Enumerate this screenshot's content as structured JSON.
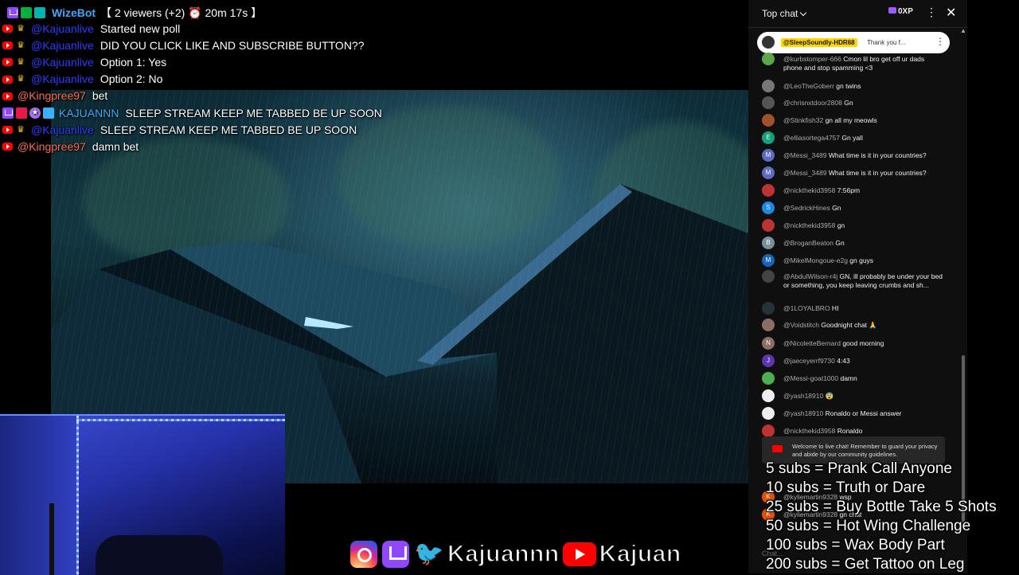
{
  "colors": {
    "wizebot": "#3ea6ff",
    "mod_blue": "#2a3cff",
    "kingpree": "#ff6a4d",
    "kajuannn": "#3ab0ff",
    "yt_bg": "#0f0f0f",
    "pinned_highlight": "#ffd600"
  },
  "viewer_bar": {
    "bot_name": "WizeBot",
    "viewers": "【 2 viewers (+2) ⏰ 20m 17s 】"
  },
  "stream_chat": [
    {
      "badges": [
        "yt",
        "crown"
      ],
      "user": "@Kajuanlive",
      "user_color": "#2a3cff",
      "msg": "Started new poll"
    },
    {
      "badges": [
        "yt",
        "crown"
      ],
      "user": "@Kajuanlive",
      "user_color": "#2a3cff",
      "msg": "DID YOU CLICK LIKE AND SUBSCRIBE BUTTON??"
    },
    {
      "badges": [
        "yt",
        "crown"
      ],
      "user": "@Kajuanlive",
      "user_color": "#2a3cff",
      "msg": "Option 1: Yes"
    },
    {
      "badges": [
        "yt",
        "crown"
      ],
      "user": "@Kajuanlive",
      "user_color": "#2a3cff",
      "msg": "Option 2: No"
    },
    {
      "badges": [
        "yt"
      ],
      "user": "@Kingpree97",
      "user_color": "#ff6a4d",
      "msg": "bet"
    },
    {
      "badges": [
        "tw",
        "red",
        "star",
        "cyan"
      ],
      "user": "KAJUANNN",
      "user_color": "#3ab0ff",
      "msg": "SLEEP STREAM KEEP ME TABBED BE UP SOON"
    },
    {
      "badges": [
        "yt",
        "crown"
      ],
      "user": "@Kajuanlive",
      "user_color": "#2a3cff",
      "msg": "SLEEP STREAM KEEP ME TABBED BE UP SOON"
    },
    {
      "badges": [
        "yt"
      ],
      "user": "@Kingpree97",
      "user_color": "#ff6a4d",
      "msg": "damn bet"
    }
  ],
  "yt_chat": {
    "title": "Top chat",
    "xp": "0XP",
    "more_icon": "more-vert-icon",
    "close_icon": "close-icon",
    "pinned": {
      "name": "@SleepSoundly-HDR68",
      "text": "Thank you f..."
    },
    "messages": [
      {
        "user": "@kurbstomper-666",
        "text": "Cmon lil bro get off ur dads phone and stop spamming <3",
        "av": "",
        "av_color": "#5aa848"
      },
      {
        "user": "@LeoTheGoberr",
        "text": "gn twins",
        "av": "",
        "av_color": "#777"
      },
      {
        "user": "@chrisnxtdoor2808",
        "text": "Gn",
        "av": "",
        "av_color": "#555"
      },
      {
        "user": "@Stinkfish32",
        "text": "gn all my meowls",
        "av": "",
        "av_color": "#a0522d"
      },
      {
        "user": "@elliasortega4757",
        "text": "Gn yall",
        "av": "E",
        "av_color": "#12a37b"
      },
      {
        "user": "@Messi_3489",
        "text": "What time is it in your countries?",
        "av": "M",
        "av_color": "#5c6bc0"
      },
      {
        "user": "@Messi_3489",
        "text": "What time is it in your countries?",
        "av": "M",
        "av_color": "#5c6bc0"
      },
      {
        "user": "@nickthekid3958",
        "text": "7:56pm",
        "av": "",
        "av_color": "#b33"
      },
      {
        "user": "@SedrickHines",
        "text": "Gn",
        "av": "S",
        "av_color": "#1e88e5"
      },
      {
        "user": "@nickthekid3958",
        "text": "gn",
        "av": "",
        "av_color": "#b33"
      },
      {
        "user": "@BroganBeaton",
        "text": "Gn",
        "av": "B",
        "av_color": "#78909c"
      },
      {
        "user": "@MikelMongoue-e2g",
        "text": "gn guys",
        "av": "M",
        "av_color": "#1565c0"
      },
      {
        "user": "@AbdulWilson-r4j",
        "text": "GN, ill probably be under your bed or something, you keep leaving crumbs and sh...",
        "av": "",
        "av_color": "#444"
      },
      {
        "user": "@1LOYALBRO",
        "text": "HI",
        "av": "",
        "av_color": "#263238"
      },
      {
        "user": "@Voidstitch",
        "text": "Goodnight chat 🙏",
        "av": "",
        "av_color": "#8d6e63"
      },
      {
        "user": "@NicoletteBernard",
        "text": "good morning",
        "av": "N",
        "av_color": "#8d6e63"
      },
      {
        "user": "@jaeceyerrf9730",
        "text": "4:43",
        "av": "J",
        "av_color": "#5e35b1"
      },
      {
        "user": "@Messi-goat1000",
        "text": "damn",
        "av": "",
        "av_color": "#4caf50"
      },
      {
        "user": "@yash18910",
        "text": "😨",
        "av": "",
        "av_color": "#eee"
      },
      {
        "user": "@yash18910",
        "text": "Ronaldo or Messi answer",
        "av": "",
        "av_color": "#eee"
      },
      {
        "user": "@nickthekid3958",
        "text": "Ronaldo",
        "av": "",
        "av_color": "#b33"
      }
    ],
    "notice": "Welcome to live chat! Remember to guard your privacy and abide by our community guidelines.",
    "partial_rows": [
      {
        "user": "@kyliemartin9328",
        "text": "wsp",
        "av": "K",
        "av_color": "#e65100"
      },
      {
        "user": "@kyliemartin9328",
        "text": "gn chat",
        "av": "K",
        "av_color": "#e65100"
      }
    ],
    "input_placeholder": "Chat..."
  },
  "socials": {
    "twitch_name": "Kajuannn",
    "youtube_name": "Kajuan"
  },
  "sub_goals": [
    "5 subs =  Prank Call Anyone",
    "10 subs = Truth or Dare",
    "25 subs = Buy Bottle Take 5 Shots",
    "50 subs = Hot Wing Challenge",
    "100 subs = Wax Body Part",
    "200 subs = Get Tattoo on Leg"
  ]
}
